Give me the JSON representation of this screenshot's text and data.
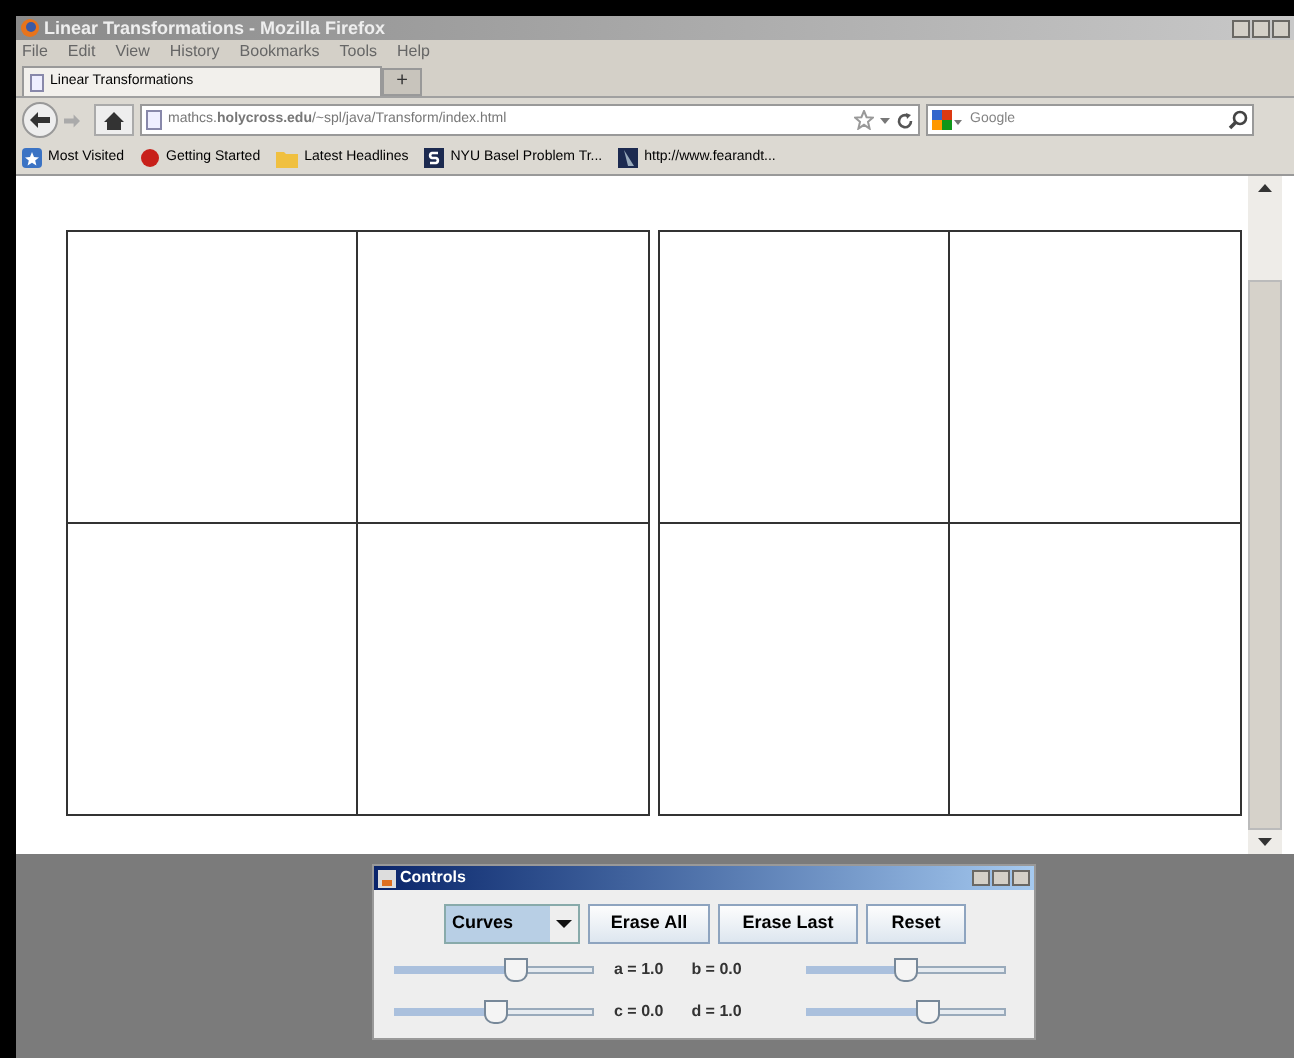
{
  "window": {
    "title": "Linear Transformations - Mozilla Firefox"
  },
  "menu": [
    "File",
    "Edit",
    "View",
    "History",
    "Bookmarks",
    "Tools",
    "Help"
  ],
  "tabs": [
    {
      "label": "Linear Transformations",
      "selected": true
    }
  ],
  "tab_add": "+",
  "address": {
    "value": "mathcs.**holycross.edu**/~spl/java/Transform/index.html"
  },
  "search": {
    "placeholder": "Google"
  },
  "bookmarks": [
    "Most Visited",
    "Getting Started",
    "Latest Headlines",
    "NYU Basel Problem Tr...",
    "http://www.fearandt..."
  ],
  "controls": {
    "title": "Controls",
    "mode": "Curves",
    "buttons": [
      "Erase All",
      "Erase Last",
      "Reset"
    ],
    "rows": [
      {
        "left": {
          "level": 0.61
        },
        "labels": [
          "a = 1.0",
          "b = 0.0"
        ],
        "right": {
          "level": 0.5
        }
      },
      {
        "left": {
          "level": 0.51
        },
        "labels": [
          "c = 0.0",
          "d = 1.0"
        ],
        "right": {
          "level": 0.61
        }
      }
    ]
  }
}
